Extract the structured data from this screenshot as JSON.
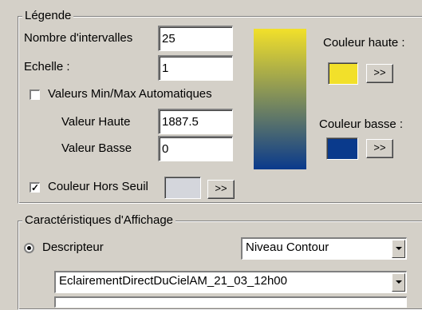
{
  "legende": {
    "title": "Légende",
    "nb_intervalles_label": "Nombre d'intervalles",
    "nb_intervalles_value": "25",
    "echelle_label": "Echelle :",
    "echelle_value": "1",
    "auto_minmax_label": "Valeurs Min/Max Automatiques",
    "auto_minmax_checked": false,
    "valeur_haute_label": "Valeur Haute",
    "valeur_haute_value": "1887.5",
    "valeur_basse_label": "Valeur Basse",
    "valeur_basse_value": "0",
    "hors_seuil_label": "Couleur Hors Seuil",
    "hors_seuil_checked": true,
    "hors_seuil_button": ">>",
    "couleur_haute_label": "Couleur haute :",
    "couleur_haute_button": ">>",
    "couleur_basse_label": "Couleur basse :",
    "couleur_basse_button": ">>",
    "colors": {
      "haute": "#f2e02a",
      "basse": "#0a3a8c",
      "hors_seuil": "#d4d6dc"
    }
  },
  "affichage": {
    "title": "Caractéristiques d'Affichage",
    "descripteur_label": "Descripteur",
    "descripteur_selected": true,
    "mode_value": "Niveau Contour",
    "dataset_value": "EclairementDirectDuCielAM_21_03_12h00"
  }
}
